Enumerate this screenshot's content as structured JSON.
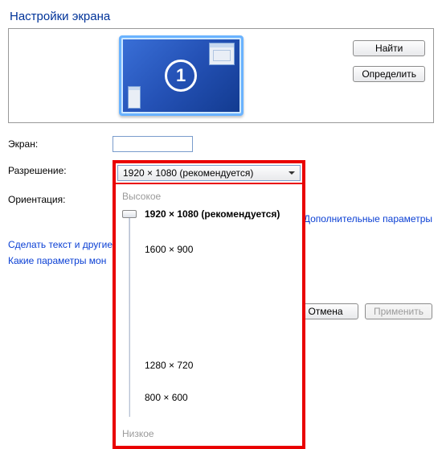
{
  "title": "Настройки экрана",
  "monitor_number": "1",
  "buttons": {
    "find": "Найти",
    "detect": "Определить",
    "cancel": "Отмена",
    "apply": "Применить"
  },
  "labels": {
    "screen": "Экран:",
    "resolution": "Разрешение:",
    "orientation": "Ориентация:"
  },
  "screen_value": "",
  "resolution_selected": "1920 × 1080 (рекомендуется)",
  "dropdown": {
    "high": "Высокое",
    "low": "Низкое",
    "options": [
      {
        "label": "1920 × 1080 (рекомендуется)",
        "gap_after": 30,
        "bold": true
      },
      {
        "label": "1600 × 900",
        "gap_after": 130,
        "bold": false
      },
      {
        "label": "1280 × 720",
        "gap_after": 26,
        "bold": false
      },
      {
        "label": "800 × 600",
        "gap_after": 0,
        "bold": false
      }
    ]
  },
  "links": {
    "advanced": "Дополнительные параметры",
    "text_size": "Сделать текст и другие",
    "which_params": "Какие параметры мон"
  }
}
